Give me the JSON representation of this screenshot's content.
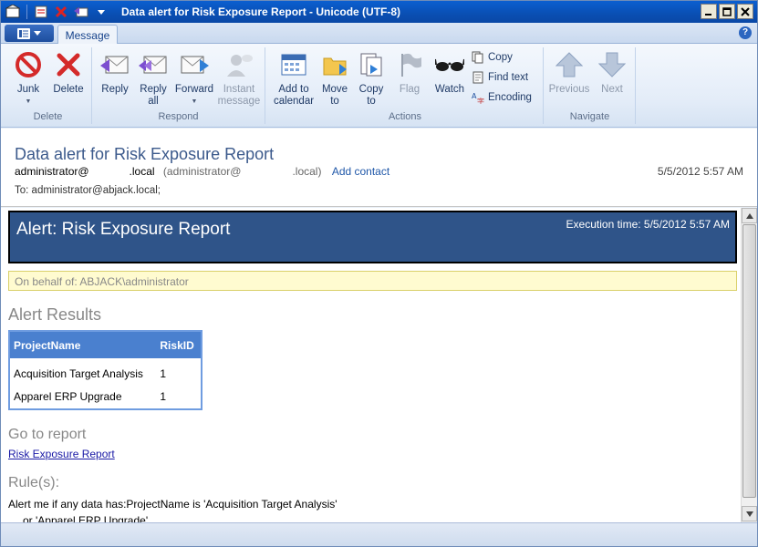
{
  "window": {
    "title": "Data alert for Risk Exposure Report - Unicode (UTF-8)"
  },
  "tabs": {
    "message": "Message"
  },
  "ribbon": {
    "delete_group": {
      "label": "Delete",
      "junk": "Junk",
      "delete": "Delete"
    },
    "respond_group": {
      "label": "Respond",
      "reply": "Reply",
      "reply_all_1": "Reply",
      "reply_all_2": "all",
      "forward": "Forward",
      "instant_1": "Instant",
      "instant_2": "message"
    },
    "actions_group": {
      "label": "Actions",
      "add_cal_1": "Add to",
      "add_cal_2": "calendar",
      "move_1": "Move",
      "move_2": "to",
      "copy_1": "Copy",
      "copy_2": "to",
      "flag": "Flag",
      "watch": "Watch",
      "copy": "Copy",
      "find_text": "Find text",
      "encoding": "Encoding"
    },
    "navigate_group": {
      "label": "Navigate",
      "previous": "Previous",
      "next": "Next"
    }
  },
  "header": {
    "subject": "Data alert for Risk Exposure Report",
    "from_name": "administrator@",
    "from_domain": ".local",
    "from_alt_open": "(administrator@",
    "from_alt_close": ".local)",
    "add_contact": "Add contact",
    "date": "5/5/2012 5:57 AM",
    "to_label": "To:",
    "to_value": "administrator@abjack.local;"
  },
  "body": {
    "alert_title": "Alert: Risk Exposure Report",
    "exec_time": "Execution time: 5/5/2012 5:57 AM",
    "behalf": "On behalf of: ABJACK\\administrator",
    "results_heading": "Alert Results",
    "table": {
      "headers": [
        "ProjectName",
        "RiskID"
      ],
      "rows": [
        [
          "Acquisition Target Analysis",
          "1"
        ],
        [
          "Apparel ERP Upgrade",
          "1"
        ]
      ]
    },
    "goto_heading": "Go to report",
    "report_link": "Risk Exposure Report",
    "rules_heading": "Rule(s):",
    "rule_line1": "Alert me if any data has:ProjectName is 'Acquisition Target Analysis'",
    "rule_line2": "or 'Apparel ERP Upgrade'"
  }
}
